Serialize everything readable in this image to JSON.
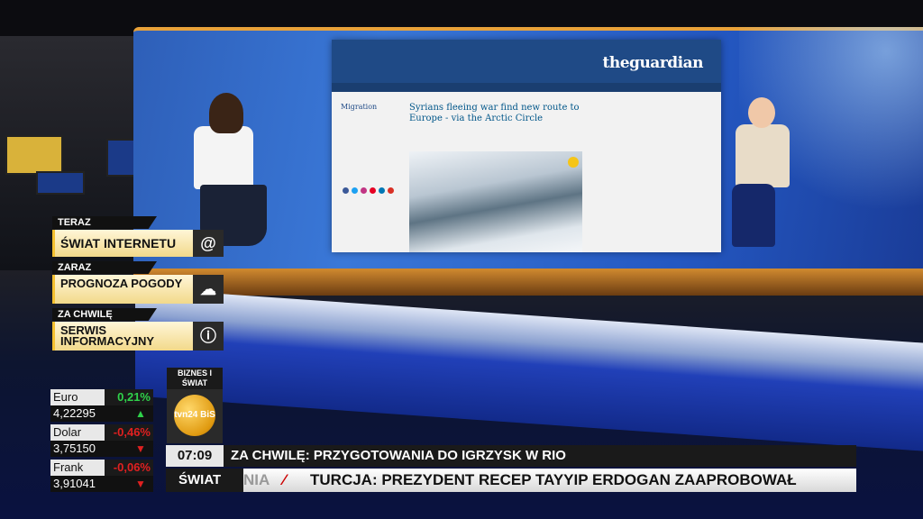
{
  "guardian_page": {
    "logo": "theguardian",
    "section": "Migration",
    "headline": "Syrians fleeing war find new route to Europe - via the Arctic Circle"
  },
  "schedule": [
    {
      "tag": "TERAZ",
      "title": "ŚWIAT INTERNETU",
      "icon": "at-sign-icon",
      "icon_glyph": "@"
    },
    {
      "tag": "ZARAZ",
      "title": "PROGNOZA POGODY",
      "icon": "weather-cloud-sun-icon",
      "icon_glyph": "☁"
    },
    {
      "tag": "ZA CHWILĘ",
      "title": "SERWIS INFORMACYJNY",
      "icon": "info-icon",
      "icon_glyph": "ⓘ"
    }
  ],
  "currencies": [
    {
      "name": "Euro",
      "change": "0,21%",
      "value": "4,22295",
      "direction": "up",
      "color": "#2fd14a"
    },
    {
      "name": "Dolar",
      "change": "-0,46%",
      "value": "3,75150",
      "direction": "down",
      "color": "#e02020"
    },
    {
      "name": "Frank",
      "change": "-0,06%",
      "value": "3,91041",
      "direction": "down",
      "color": "#e02020"
    }
  ],
  "channel": {
    "program": "BIZNES I ŚWIAT",
    "logo_text": "tvn24 BiS"
  },
  "ticker": {
    "time": "07:09",
    "headline": "ZA CHWILĘ: PRZYGOTOWANIA DO IGRZYSK W RIO",
    "section": "ŚWIAT",
    "crawl_previous": "NIA",
    "crawl_separator": "⁄",
    "crawl_text": "TURCJA: PREZYDENT RECEP TAYYIP ERDOGAN ZAAPROBOWAŁ"
  },
  "colors": {
    "accent_gold": "#f4c030",
    "positive": "#2fd14a",
    "negative": "#e02020"
  }
}
